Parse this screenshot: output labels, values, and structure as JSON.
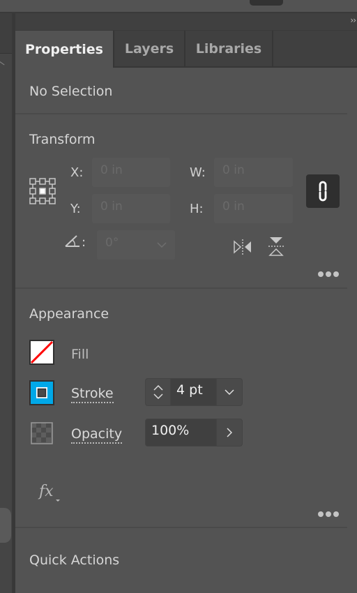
{
  "panel": {
    "collapse_icon": "double-chevron-right-icon",
    "tabs": [
      {
        "label": "Properties",
        "active": true
      },
      {
        "label": "Layers",
        "active": false
      },
      {
        "label": "Libraries",
        "active": false
      }
    ]
  },
  "selection": {
    "status": "No Selection"
  },
  "transform": {
    "title": "Transform",
    "x_label": "X:",
    "x_value": "0 in",
    "y_label": "Y:",
    "y_value": "0 in",
    "w_label": "W:",
    "w_value": "0 in",
    "h_label": "H:",
    "h_value": "0 in",
    "angle_label": ":",
    "angle_value": "0°",
    "reference_point_icon": "reference-point-grid-icon",
    "link_icon": "link-icon",
    "flip_horizontal_icon": "flip-horizontal-icon",
    "flip_vertical_icon": "flip-vertical-icon",
    "more_icon": "more-options-icon"
  },
  "appearance": {
    "title": "Appearance",
    "fill_label": "Fill",
    "stroke_label": "Stroke",
    "stroke_weight": "4 pt",
    "opacity_label": "Opacity",
    "opacity_value": "100%",
    "fx_label": "fx",
    "colors": {
      "none_slash": "#ff0000",
      "stroke_swatch": "#00a8e8"
    },
    "more_icon": "more-options-icon"
  },
  "quick_actions": {
    "title": "Quick Actions"
  }
}
